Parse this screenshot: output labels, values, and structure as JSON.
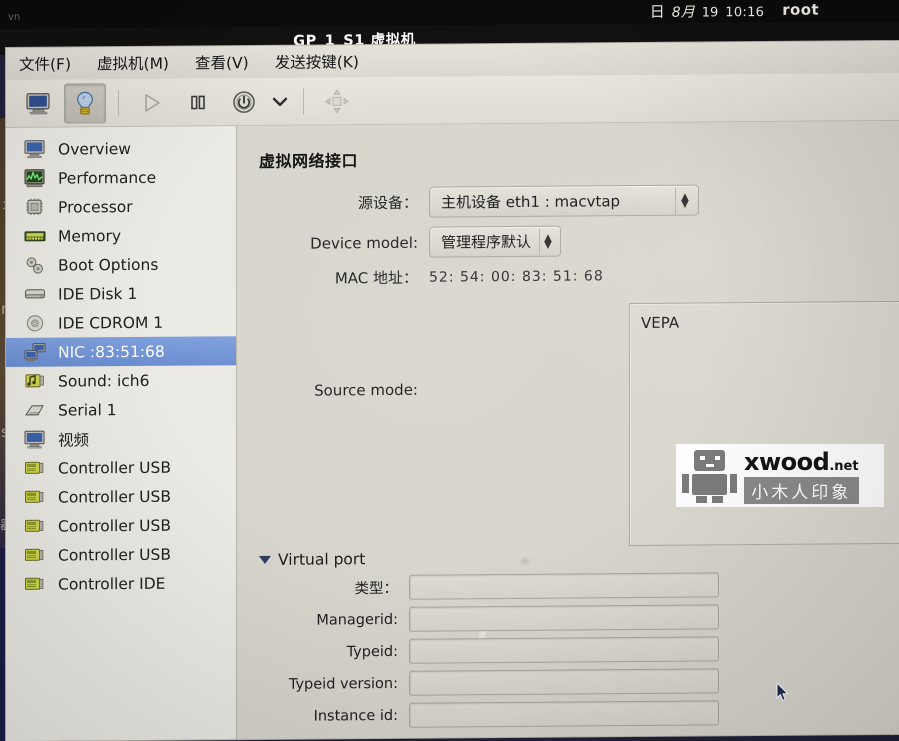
{
  "panel": {
    "clock_day": "日",
    "clock_month": "8月",
    "clock_date": "19",
    "clock_time": "10:16",
    "user": "root",
    "ghost_left": "vn"
  },
  "window": {
    "title": "GP_1_S1 虚拟机"
  },
  "menubar": {
    "items": [
      {
        "label": "文件(F)",
        "name": "menu-file"
      },
      {
        "label": "虚拟机(M)",
        "name": "menu-virtual-machine"
      },
      {
        "label": "查看(V)",
        "name": "menu-view"
      },
      {
        "label": "发送按键(K)",
        "name": "menu-send-key"
      }
    ]
  },
  "toolbar": {
    "buttons": [
      {
        "icon": "monitor-icon",
        "label": "显示图形控制台",
        "pressed": false,
        "disabled": false
      },
      {
        "icon": "lightbulb-details-icon",
        "label": "显示虚拟硬件详情",
        "pressed": true,
        "disabled": false
      },
      {
        "icon": "play-icon",
        "label": "运行",
        "pressed": false,
        "disabled": true
      },
      {
        "icon": "pause-icon",
        "label": "暂停",
        "pressed": false,
        "disabled": false
      },
      {
        "icon": "power-icon",
        "label": "关闭",
        "pressed": false,
        "disabled": false
      },
      {
        "icon": "chevron-down-icon",
        "label": "关机菜单",
        "pressed": false,
        "disabled": false
      },
      {
        "icon": "fullscreen-icon",
        "label": "全屏",
        "pressed": false,
        "disabled": false
      }
    ]
  },
  "sidebar": {
    "items": [
      {
        "label": "Overview",
        "icon": "monitor-icon",
        "selected": false
      },
      {
        "label": "Performance",
        "icon": "performance-graph-icon",
        "selected": false
      },
      {
        "label": "Processor",
        "icon": "cpu-chip-icon",
        "selected": false
      },
      {
        "label": "Memory",
        "icon": "memory-stick-icon",
        "selected": false
      },
      {
        "label": "Boot Options",
        "icon": "gears-icon",
        "selected": false
      },
      {
        "label": "IDE Disk 1",
        "icon": "harddisk-icon",
        "selected": false
      },
      {
        "label": "IDE CDROM 1",
        "icon": "cdrom-icon",
        "selected": false
      },
      {
        "label": "NIC :83:51:68",
        "icon": "network-card-icon",
        "selected": true
      },
      {
        "label": "Sound: ich6",
        "icon": "sound-card-icon",
        "selected": false
      },
      {
        "label": "Serial 1",
        "icon": "serial-port-icon",
        "selected": false
      },
      {
        "label": "视频",
        "icon": "video-icon",
        "selected": false
      },
      {
        "label": "Controller USB",
        "icon": "controller-card-icon",
        "selected": false
      },
      {
        "label": "Controller USB",
        "icon": "controller-card-icon",
        "selected": false
      },
      {
        "label": "Controller USB",
        "icon": "controller-card-icon",
        "selected": false
      },
      {
        "label": "Controller USB",
        "icon": "controller-card-icon",
        "selected": false
      },
      {
        "label": "Controller IDE",
        "icon": "controller-card-icon",
        "selected": false
      }
    ]
  },
  "main": {
    "section_title": "虚拟网络接口",
    "source_device": {
      "label": "源设备：",
      "value": "主机设备  eth1 : macvtap"
    },
    "device_model": {
      "label": "Device model:",
      "value": "管理程序默认"
    },
    "mac_address": {
      "label": "MAC 地址：",
      "value": "52: 54: 00: 83: 51: 68"
    },
    "source_mode": {
      "label": "Source mode:",
      "value": "VEPA"
    },
    "virtual_port": {
      "expander_label": "Virtual port",
      "expanded": true,
      "fields": [
        {
          "label": "类型：",
          "value": "",
          "name": "virtual-port-type-input"
        },
        {
          "label": "Managerid:",
          "value": "",
          "name": "virtual-port-managerid-input"
        },
        {
          "label": "Typeid:",
          "value": "",
          "name": "virtual-port-typeid-input"
        },
        {
          "label": "Typeid version:",
          "value": "",
          "name": "virtual-port-typeid-version-input"
        },
        {
          "label": "Instance id:",
          "value": "",
          "name": "virtual-port-instance-id-input"
        }
      ]
    }
  },
  "watermark": {
    "brand": "xwood",
    "tld": ".net",
    "subtitle": "小木人印象"
  },
  "colors": {
    "selection_blue": "#6b8ed2",
    "window_bg": "#d8d5cd",
    "sidebar_bg": "#eceae4",
    "panel_bg": "#0b0b0b"
  }
}
